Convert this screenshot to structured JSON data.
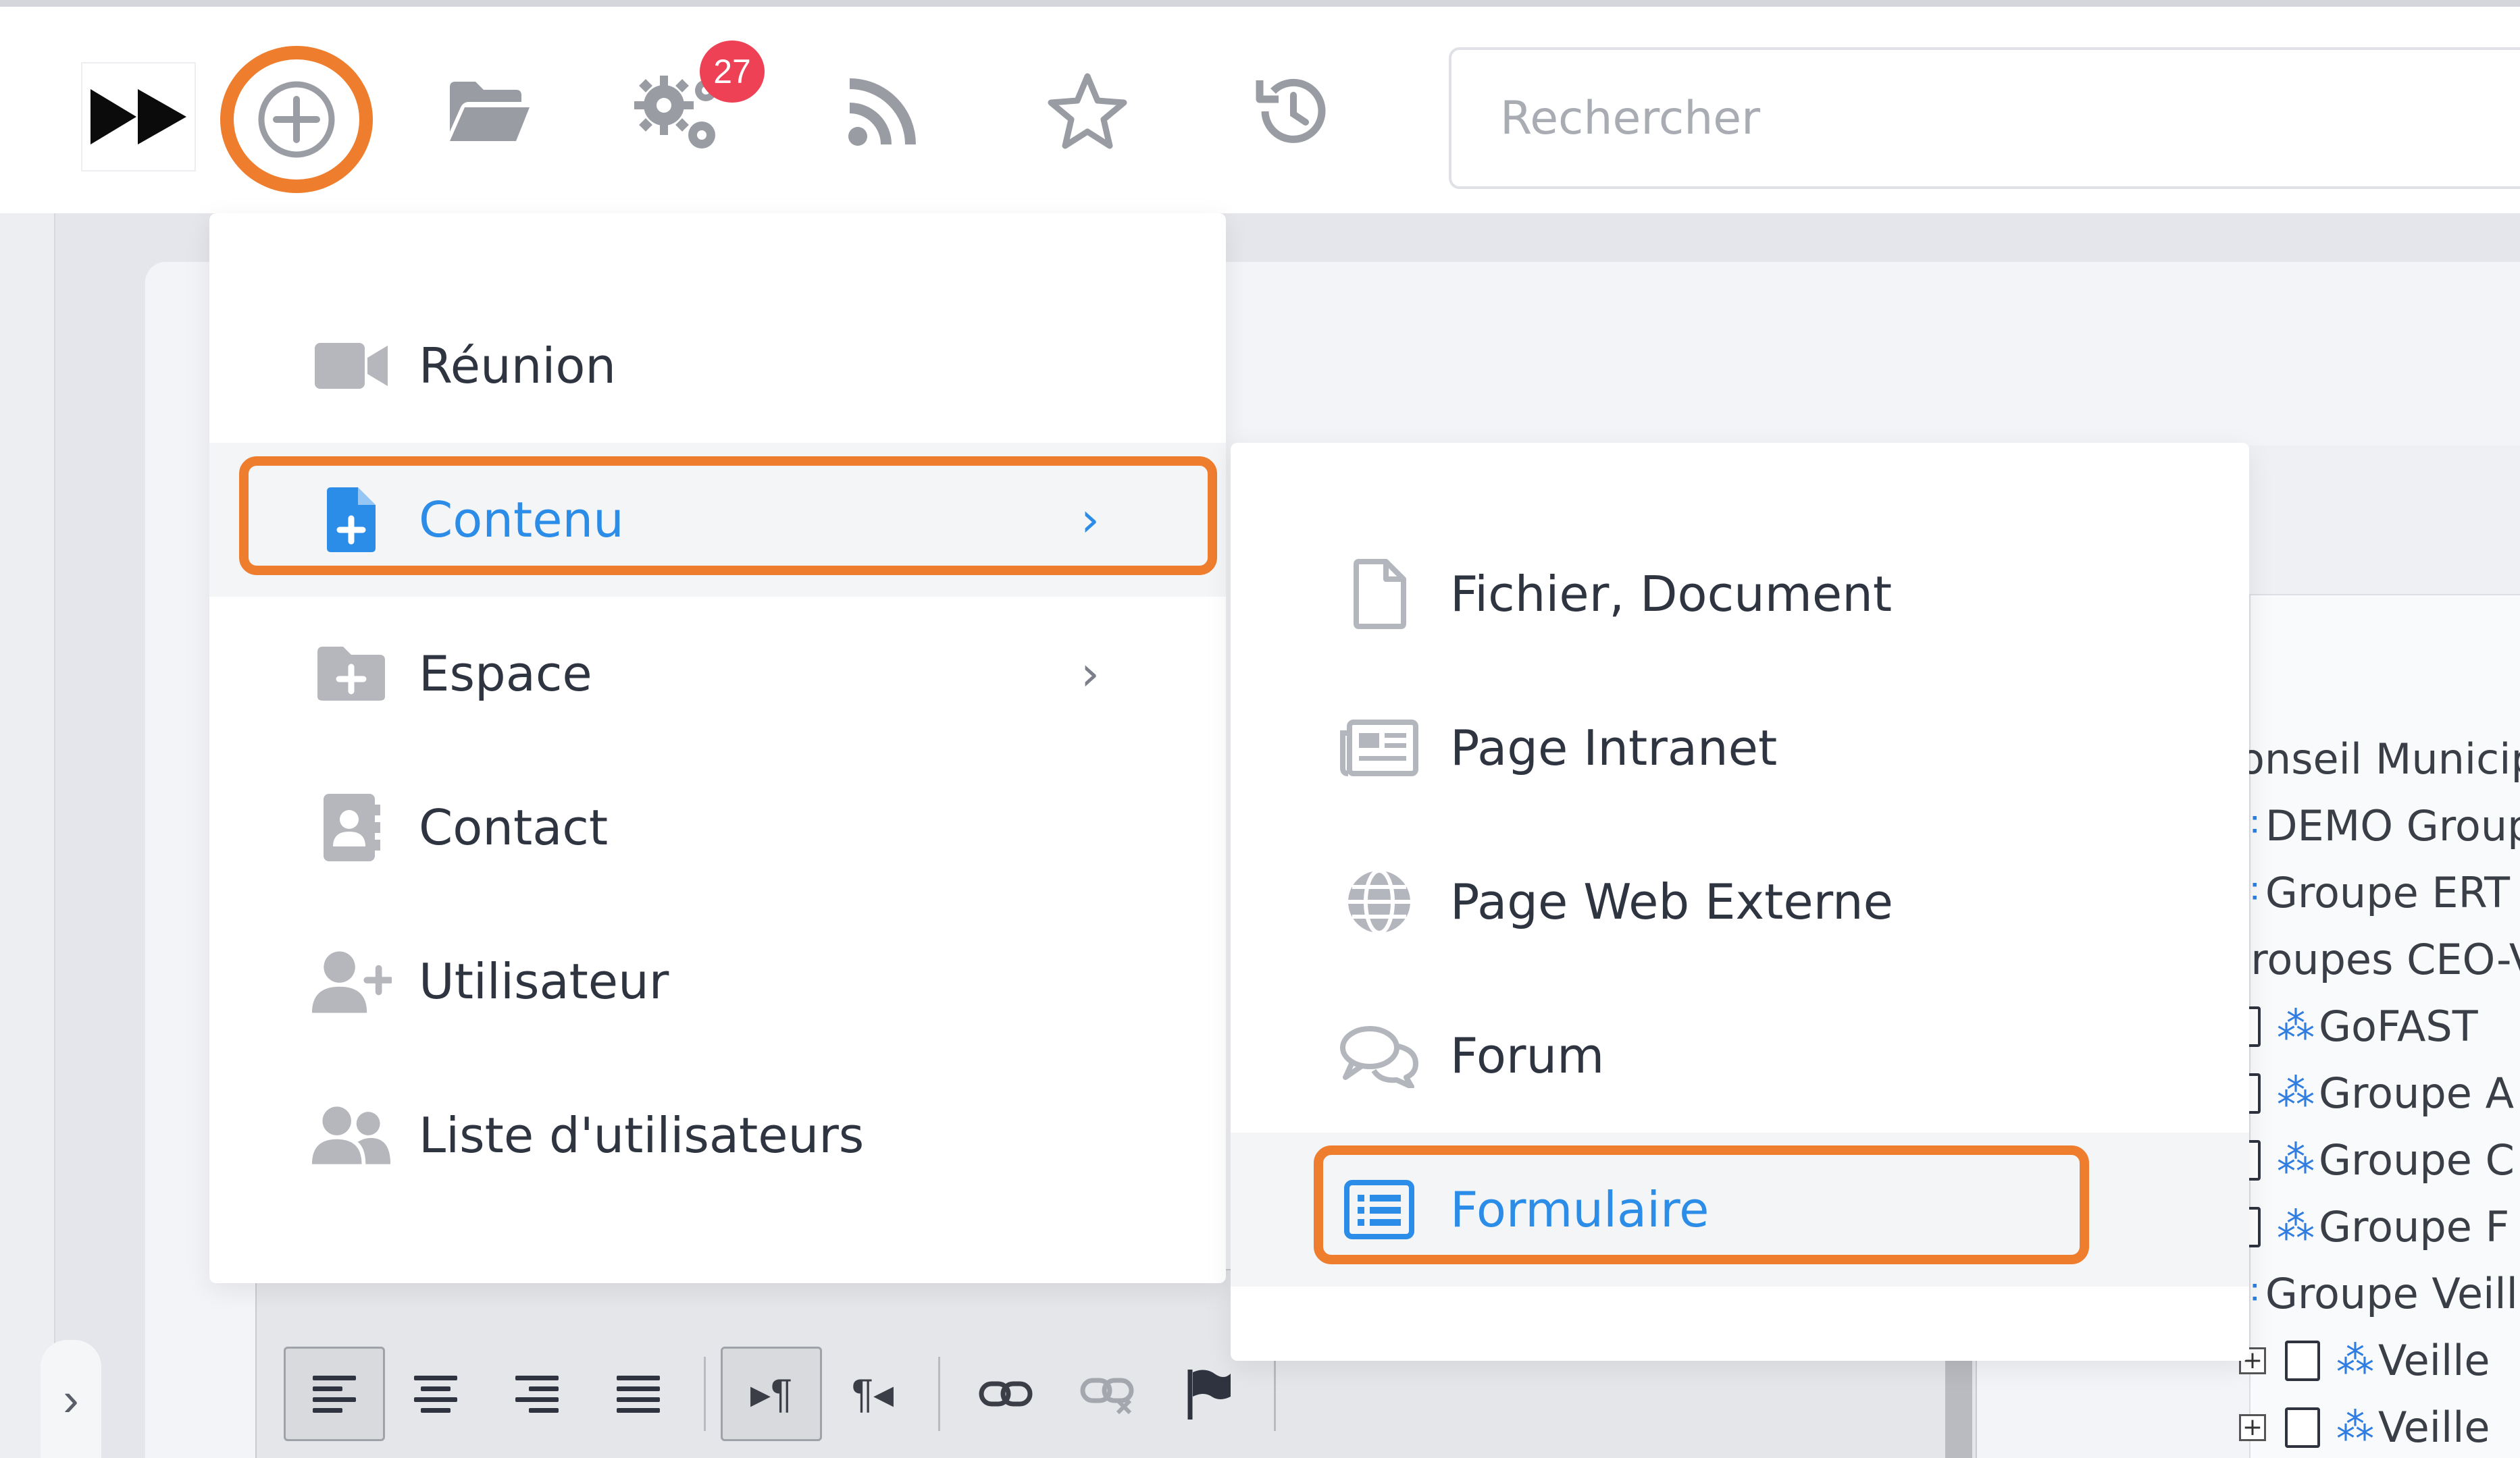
{
  "topbar": {
    "notification_count": "27",
    "search_placeholder": "Rechercher",
    "icons": [
      "fast-forward-logo",
      "plus-circle-icon",
      "folder-open-icon",
      "gears-icon",
      "rss-icon",
      "star-icon",
      "history-icon"
    ]
  },
  "menu": {
    "items": [
      {
        "label": "Réunion",
        "icon": "video-camera-icon",
        "has_submenu": false
      },
      {
        "label": "Contenu",
        "icon": "file-plus-icon",
        "has_submenu": true,
        "active": true
      },
      {
        "label": "Espace",
        "icon": "folder-plus-icon",
        "has_submenu": true
      },
      {
        "label": "Contact",
        "icon": "address-book-icon",
        "has_submenu": false
      },
      {
        "label": "Utilisateur",
        "icon": "user-plus-icon",
        "has_submenu": false
      },
      {
        "label": "Liste d'utilisateurs",
        "icon": "users-icon",
        "has_submenu": false
      }
    ],
    "chevron": "›"
  },
  "submenu": {
    "items": [
      {
        "label": "Fichier, Document",
        "icon": "file-icon"
      },
      {
        "label": "Page Intranet",
        "icon": "newspaper-icon"
      },
      {
        "label": "Page Web Externe",
        "icon": "globe-icon"
      },
      {
        "label": "Forum",
        "icon": "comments-icon"
      },
      {
        "label": "Formulaire",
        "icon": "list-form-icon",
        "active": true
      }
    ]
  },
  "tree": {
    "rows": [
      {
        "label": "onseil Municip"
      },
      {
        "label": "DEMO Group"
      },
      {
        "label": "Groupe ERT"
      },
      {
        "label": "iroupes CEO-V"
      },
      {
        "label": "GoFAST"
      },
      {
        "label": "Groupe A"
      },
      {
        "label": "Groupe C"
      },
      {
        "label": "Groupe F"
      },
      {
        "label": "Groupe Veill"
      },
      {
        "label": "Veille"
      },
      {
        "label": "Veille"
      }
    ]
  },
  "colors": {
    "highlight": "#ee7d2e",
    "accent": "#2b8de8",
    "badge": "#ee4155"
  }
}
